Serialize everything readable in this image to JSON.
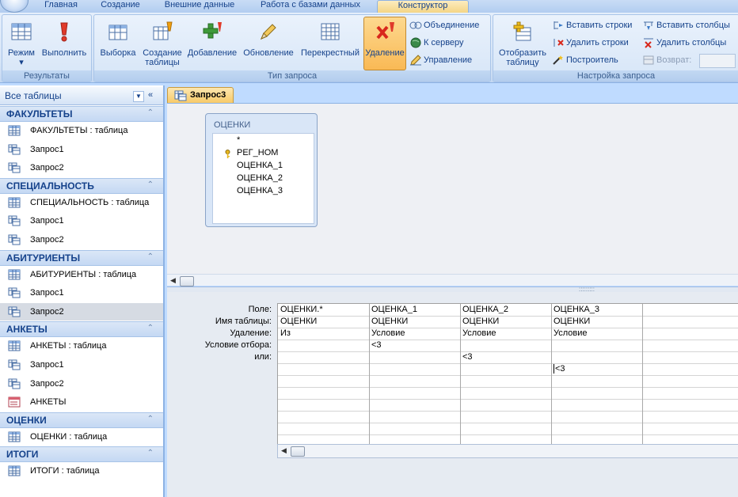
{
  "tabs": [
    "Главная",
    "Создание",
    "Внешние данные",
    "Работа с базами данных",
    "Конструктор"
  ],
  "ribbon": {
    "results": {
      "label": "Результаты",
      "mode": "Режим",
      "run": "Выполнить"
    },
    "query_type": {
      "label": "Тип запроса",
      "select": "Выборка",
      "make_table_1": "Создание",
      "make_table_2": "таблицы",
      "append": "Добавление",
      "update": "Обновление",
      "crosstab": "Перекрестный",
      "delete": "Удаление",
      "union": "Объединение",
      "pass_through": "К серверу",
      "data_definition": "Управление"
    },
    "query_setup": {
      "label": "Настройка запроса",
      "show_table_1": "Отобразить",
      "show_table_2": "таблицу",
      "insert_rows": "Вставить строки",
      "delete_rows": "Удалить строки",
      "builder": "Построитель",
      "insert_columns": "Вставить столбцы",
      "delete_columns": "Удалить столбцы",
      "return": "Возврат:"
    }
  },
  "nav": {
    "title": "Все таблицы",
    "categories": [
      {
        "name": "ФАКУЛЬТЕТЫ",
        "items": [
          {
            "name": "ФАКУЛЬТЕТЫ : таблица",
            "type": "table"
          },
          {
            "name": "Запрос1",
            "type": "query"
          },
          {
            "name": "Запрос2",
            "type": "query"
          }
        ]
      },
      {
        "name": "СПЕЦИАЛЬНОСТЬ",
        "items": [
          {
            "name": "СПЕЦИАЛЬНОСТЬ : таблица",
            "type": "table"
          },
          {
            "name": "Запрос1",
            "type": "query"
          },
          {
            "name": "Запрос2",
            "type": "query"
          }
        ]
      },
      {
        "name": "АБИТУРИЕНТЫ",
        "items": [
          {
            "name": "АБИТУРИЕНТЫ : таблица",
            "type": "table"
          },
          {
            "name": "Запрос1",
            "type": "query"
          },
          {
            "name": "Запрос2",
            "type": "query",
            "selected": true
          }
        ]
      },
      {
        "name": "АНКЕТЫ",
        "items": [
          {
            "name": "АНКЕТЫ : таблица",
            "type": "table"
          },
          {
            "name": "Запрос1",
            "type": "query"
          },
          {
            "name": "Запрос2",
            "type": "query"
          },
          {
            "name": "АНКЕТЫ",
            "type": "form"
          }
        ]
      },
      {
        "name": "ОЦЕНКИ",
        "items": [
          {
            "name": "ОЦЕНКИ : таблица",
            "type": "table"
          }
        ]
      },
      {
        "name": "ИТОГИ",
        "items": [
          {
            "name": "ИТОГИ : таблица",
            "type": "table"
          }
        ]
      }
    ]
  },
  "document": {
    "tab_title": "Запрос3",
    "table": {
      "title": "ОЦЕНКИ",
      "fields": [
        "*",
        "РЕГ_НОМ",
        "ОЦЕНКА_1",
        "ОЦЕНКА_2",
        "ОЦЕНКА_3"
      ],
      "key_field": "РЕГ_НОМ"
    },
    "grid": {
      "row_labels": [
        "Поле:",
        "Имя таблицы:",
        "Удаление:",
        "Условие отбора:",
        "или:"
      ],
      "columns": [
        {
          "field": "ОЦЕНКИ.*",
          "table": "ОЦЕНКИ",
          "delete": "Из",
          "criteria": "",
          "or": ""
        },
        {
          "field": "ОЦЕНКА_1",
          "table": "ОЦЕНКИ",
          "delete": "Условие",
          "criteria": "<3",
          "or": ""
        },
        {
          "field": "ОЦЕНКА_2",
          "table": "ОЦЕНКИ",
          "delete": "Условие",
          "criteria": "",
          "or": "<3"
        },
        {
          "field": "ОЦЕНКА_3",
          "table": "ОЦЕНКИ",
          "delete": "Условие",
          "criteria": "",
          "or": "",
          "extra": "<3"
        }
      ]
    }
  },
  "colors": {
    "accent": "#15428b",
    "ribbon_bg": "#d5e4f7",
    "pressed": "#f9b955",
    "doc_tab": "#f7c864"
  }
}
